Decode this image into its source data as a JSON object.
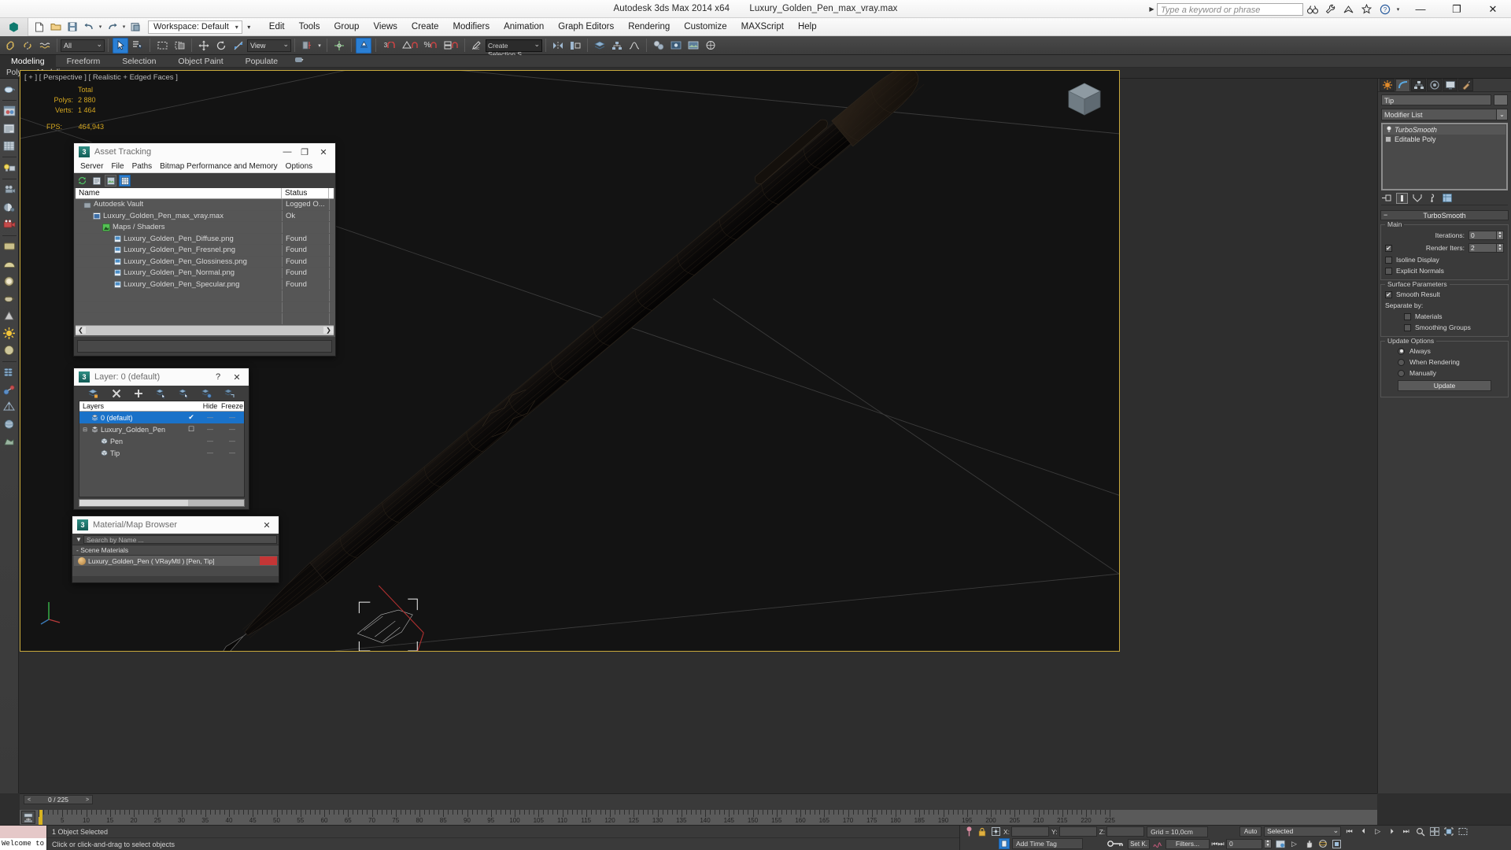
{
  "titlebar": {
    "app_title": "Autodesk 3ds Max  2014 x64",
    "file_name": "Luxury_Golden_Pen_max_vray.max",
    "search_placeholder": "Type a keyword or phrase",
    "icons": [
      "binoculars-icon",
      "wrench-icon",
      "subscription-icon",
      "star-icon",
      "help-icon"
    ],
    "window_buttons": [
      "minimize",
      "maximize",
      "close"
    ]
  },
  "menubar": {
    "workspace_label": "Workspace: Default",
    "quick_access": [
      "new-icon",
      "open-icon",
      "save-icon",
      "undo-icon",
      "redo-icon",
      "project-folder-icon"
    ],
    "items": [
      "Edit",
      "Tools",
      "Group",
      "Views",
      "Create",
      "Modifiers",
      "Animation",
      "Graph Editors",
      "Rendering",
      "Customize",
      "MAXScript",
      "Help"
    ]
  },
  "main_toolbar": {
    "selection_filter": "All",
    "reference_coord": "View",
    "named_selection_sets": "Create Selection S",
    "snap_number": "3"
  },
  "ribbon": {
    "tabs": [
      "Modeling",
      "Freeform",
      "Selection",
      "Object Paint",
      "Populate"
    ],
    "active_tab": "Modeling",
    "subtitle": "Polygon Modeling"
  },
  "viewport": {
    "label": "[ + ] [ Perspective ] [ Realistic + Edged Faces ]",
    "stats_header": "Total",
    "stats": [
      {
        "label": "Polys:",
        "value": "2 880"
      },
      {
        "label": "Verts:",
        "value": "1 464"
      }
    ],
    "fps_label": "FPS:",
    "fps_value": "464,943"
  },
  "asset_tracking": {
    "title": "Asset Tracking",
    "menu": [
      "Server",
      "File",
      "Paths",
      "Bitmap Performance and Memory",
      "Options"
    ],
    "toolbar_icons": [
      "refresh-icon",
      "list-view-icon",
      "thumbnail-view-icon",
      "table-view-icon"
    ],
    "columns": [
      "Name",
      "Status",
      ""
    ],
    "rows": [
      {
        "name": "Autodesk Vault",
        "status": "Logged O...",
        "indent": 0,
        "icon": "vault-icon"
      },
      {
        "name": "Luxury_Golden_Pen_max_vray.max",
        "status": "Ok",
        "indent": 1,
        "icon": "maxfile-icon"
      },
      {
        "name": "Maps / Shaders",
        "status": "",
        "indent": 2,
        "icon": "maps-icon"
      },
      {
        "name": "Luxury_Golden_Pen_Diffuse.png",
        "status": "Found",
        "indent": 3,
        "icon": "bitmap-icon"
      },
      {
        "name": "Luxury_Golden_Pen_Fresnel.png",
        "status": "Found",
        "indent": 3,
        "icon": "bitmap-icon"
      },
      {
        "name": "Luxury_Golden_Pen_Glossiness.png",
        "status": "Found",
        "indent": 3,
        "icon": "bitmap-icon"
      },
      {
        "name": "Luxury_Golden_Pen_Normal.png",
        "status": "Found",
        "indent": 3,
        "icon": "bitmap-icon"
      },
      {
        "name": "Luxury_Golden_Pen_Specular.png",
        "status": "Found",
        "indent": 3,
        "icon": "bitmap-icon"
      }
    ]
  },
  "layer_dialog": {
    "title": "Layer: 0 (default)",
    "help_label": "?",
    "toolbar_icons": [
      "create-new-layer-icon",
      "delete-layer-icon",
      "add-selection-icon",
      "select-objects-icon",
      "select-highlight-icon",
      "highlight-selected-icon",
      "hide-unselected-icon"
    ],
    "columns": [
      "Layers",
      "",
      "Hide",
      "Freeze"
    ],
    "rows": [
      {
        "name": "0 (default)",
        "selected": true,
        "indent": 0,
        "current": "✔",
        "hide": "—",
        "freeze": "—"
      },
      {
        "name": "Luxury_Golden_Pen",
        "selected": false,
        "indent": 0,
        "current": "☐",
        "hide": "—",
        "freeze": "—"
      },
      {
        "name": "Pen",
        "selected": false,
        "indent": 1,
        "current": "",
        "hide": "—",
        "freeze": "—"
      },
      {
        "name": "Tip",
        "selected": false,
        "indent": 1,
        "current": "",
        "hide": "—",
        "freeze": "—"
      }
    ]
  },
  "material_browser": {
    "title": "Material/Map Browser",
    "search_placeholder": "Search by Name ...",
    "group_label": "- Scene Materials",
    "materials": [
      {
        "name": "Luxury_Golden_Pen  ( VRayMtl )  [Pen, Tip]"
      }
    ]
  },
  "command_panel": {
    "tabs": [
      "create-tab",
      "modify-tab",
      "hierarchy-tab",
      "motion-tab",
      "display-tab",
      "utilities-tab"
    ],
    "active_tab": "modify-tab",
    "object_name": "Tip",
    "modifier_list_label": "Modifier List",
    "stack": [
      {
        "label": "TurboSmooth",
        "active": true
      },
      {
        "label": "Editable Poly",
        "active": false
      }
    ],
    "stack_buttons": [
      "pin-stack-icon",
      "show-end-result-icon",
      "make-unique-icon",
      "remove-modifier-icon",
      "configure-sets-icon"
    ],
    "rollout_title": "TurboSmooth",
    "groups": {
      "main": {
        "label": "Main",
        "iterations_label": "Iterations:",
        "iterations_value": "0",
        "render_iters_label": "Render Iters:",
        "render_iters_value": "2",
        "render_iters_checked": true,
        "isoline_label": "Isoline Display",
        "isoline_checked": false,
        "explicit_label": "Explicit Normals",
        "explicit_checked": false
      },
      "surface": {
        "label": "Surface Parameters",
        "smooth_result_label": "Smooth Result",
        "smooth_result_checked": true,
        "separate_label": "Separate by:",
        "materials_label": "Materials",
        "materials_checked": false,
        "smoothing_groups_label": "Smoothing Groups",
        "smoothing_groups_checked": false
      },
      "update": {
        "label": "Update Options",
        "options": [
          "Always",
          "When Rendering",
          "Manually"
        ],
        "selected": "Always",
        "button_label": "Update"
      }
    }
  },
  "timeline": {
    "frame_display": "0 / 225",
    "prev_label": "<",
    "next_label": ">",
    "tick_labels": [
      "5",
      "10",
      "15",
      "20",
      "25",
      "30",
      "35",
      "40",
      "45",
      "50",
      "55",
      "60",
      "65",
      "70",
      "75",
      "80",
      "85",
      "90",
      "95",
      "100",
      "105",
      "110",
      "115",
      "120",
      "125",
      "130",
      "135",
      "140",
      "145",
      "150",
      "155",
      "160",
      "165",
      "170",
      "175",
      "180",
      "185",
      "190",
      "195",
      "200",
      "205",
      "210",
      "215",
      "220",
      "225"
    ]
  },
  "statusbar": {
    "maxscript_listener": "Welcome to",
    "selection_status": "1 Object Selected",
    "prompt": "Click or click-and-drag to select objects",
    "coords": {
      "x_label": "X:",
      "x_value": "",
      "y_label": "Y:",
      "y_value": "",
      "z_label": "Z:",
      "z_value": ""
    },
    "grid_label": "Grid = 10,0cm",
    "time_tag": "Add Time Tag",
    "auto_key": "Auto",
    "set_key": "Set K.",
    "key_filter": "Selected",
    "filters": "Filters...",
    "current_frame": "0",
    "nav_icons": [
      "go-to-start",
      "prev-frame",
      "play",
      "next-frame",
      "go-to-end"
    ],
    "viewport_nav": [
      "zoom-icon",
      "zoom-all-icon",
      "zoom-extents-icon",
      "zoom-region-icon",
      "pan-icon",
      "orbit-icon",
      "maximize-viewport-icon"
    ]
  },
  "colors": {
    "accent_blue": "#2a7fd4",
    "viewport_border": "#c8a93c",
    "stats_yellow": "#d3a620",
    "panel_bg": "#3a3a3a",
    "selected_row": "#1a72c9"
  }
}
